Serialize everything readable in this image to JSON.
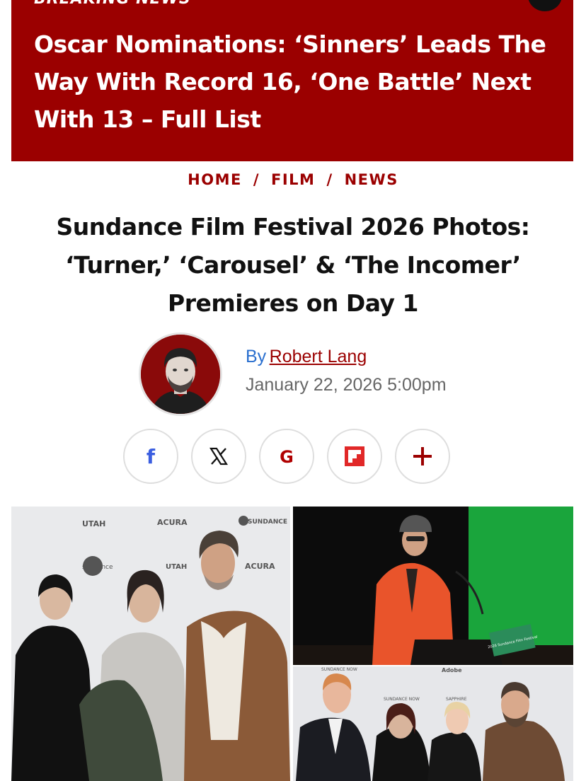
{
  "breaking": {
    "label": "BREAKING NEWS",
    "headline": "Oscar Nominations: ‘Sinners’ Leads The Way With Record 16, ‘One Battle’ Next With 13 – Full List"
  },
  "breadcrumb": {
    "home": "HOME",
    "film": "FILM",
    "news": "NEWS",
    "separator": "/"
  },
  "article": {
    "title": "Sundance Film Festival 2026 Photos: ‘Turner,’ ‘Carousel’ & ‘The Incomer’ Premieres on Day 1",
    "by": "By",
    "author": "Robert Lang",
    "date": "January 22, 2026 5:00pm"
  },
  "share": {
    "icons": [
      "facebook-icon",
      "x-icon",
      "google-icon",
      "flipboard-icon",
      "plus-icon"
    ]
  },
  "photos": {
    "sponsor_wall": [
      "UTAH",
      "ACURA",
      "SUNDANCE",
      "sundance",
      "ACURA",
      "UTAH",
      "Adobe",
      "SUNDANCE NOW",
      "SAPPHIRE"
    ],
    "podium_sign": "2026 Sundance Film Festival"
  },
  "colors": {
    "brand_red": "#9b0000",
    "byline_blue": "#2a6fcf",
    "date_grey": "#666666",
    "facebook_blue": "#3b5ee0"
  }
}
